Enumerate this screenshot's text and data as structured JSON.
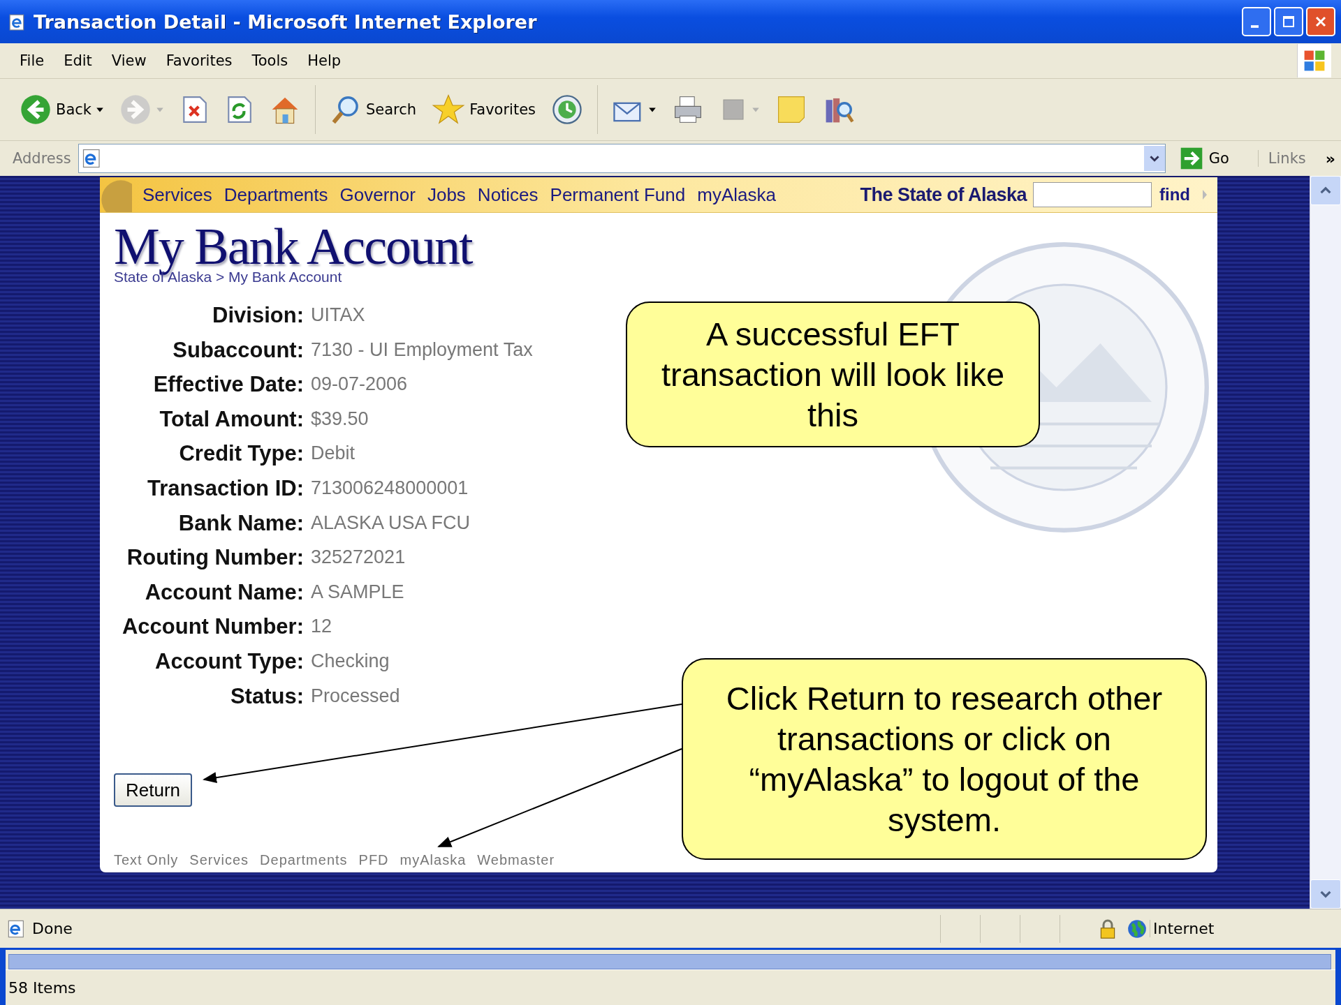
{
  "window": {
    "title": "Transaction Detail - Microsoft Internet Explorer"
  },
  "menu": [
    "File",
    "Edit",
    "View",
    "Favorites",
    "Tools",
    "Help"
  ],
  "toolbar": [
    {
      "kind": "back",
      "label": "Back",
      "dropdown": true,
      "disabled": false
    },
    {
      "kind": "forward",
      "dropdown": true,
      "disabled": true
    },
    {
      "kind": "stop",
      "dropdown": false,
      "disabled": false
    },
    {
      "kind": "refresh",
      "dropdown": false,
      "disabled": false
    },
    {
      "kind": "home",
      "dropdown": false,
      "disabled": false
    },
    {
      "kind": "separator"
    },
    {
      "kind": "search",
      "label": "Search",
      "dropdown": false,
      "disabled": false
    },
    {
      "kind": "favorites",
      "label": "Favorites",
      "dropdown": false,
      "disabled": false
    },
    {
      "kind": "history",
      "dropdown": false,
      "disabled": false
    },
    {
      "kind": "separator"
    },
    {
      "kind": "mail",
      "dropdown": true,
      "disabled": false
    },
    {
      "kind": "print",
      "dropdown": false,
      "disabled": false
    },
    {
      "kind": "edit",
      "dropdown": true,
      "disabled": true
    },
    {
      "kind": "note",
      "dropdown": false,
      "disabled": false
    },
    {
      "kind": "research",
      "dropdown": false,
      "disabled": false
    }
  ],
  "address_bar": {
    "label": "Address",
    "go": "Go",
    "links": "Links",
    "more": "»"
  },
  "site_nav": {
    "links": [
      "Services",
      "Departments",
      "Governor",
      "Jobs",
      "Notices",
      "Permanent Fund",
      "myAlaska"
    ],
    "brand": "The State of Alaska",
    "find": "find"
  },
  "page": {
    "heading": "My Bank Account",
    "breadcrumb": "State of Alaska > My Bank Account"
  },
  "fields": [
    {
      "label": "Division:",
      "value": "UITAX"
    },
    {
      "label": "Subaccount:",
      "value": "7130 - UI Employment Tax"
    },
    {
      "label": "Effective Date:",
      "value": "09-07-2006"
    },
    {
      "label": "Total Amount:",
      "value": "$39.50"
    },
    {
      "label": "Credit Type:",
      "value": "Debit"
    },
    {
      "label": "Transaction ID:",
      "value": "713006248000001"
    },
    {
      "label": "Bank Name:",
      "value": "ALASKA USA FCU"
    },
    {
      "label": "Routing Number:",
      "value": "325272021"
    },
    {
      "label": "Account Name:",
      "value": "A SAMPLE"
    },
    {
      "label": "Account Number:",
      "value": "12"
    },
    {
      "label": "Account Type:",
      "value": "Checking"
    },
    {
      "label": "Status:",
      "value": "Processed"
    }
  ],
  "return_button": "Return",
  "footer_links": [
    "Text Only",
    "Services",
    "Departments",
    "PFD",
    "myAlaska",
    "Webmaster"
  ],
  "callouts": [
    {
      "text": "A successful EFT transaction will look like this"
    },
    {
      "text": "Click Return to research other transactions or click on “myAlaska” to logout of the system."
    }
  ],
  "status_bar": {
    "text": "Done",
    "zone": "Internet"
  },
  "lower_window": {
    "status": "58 Items"
  }
}
